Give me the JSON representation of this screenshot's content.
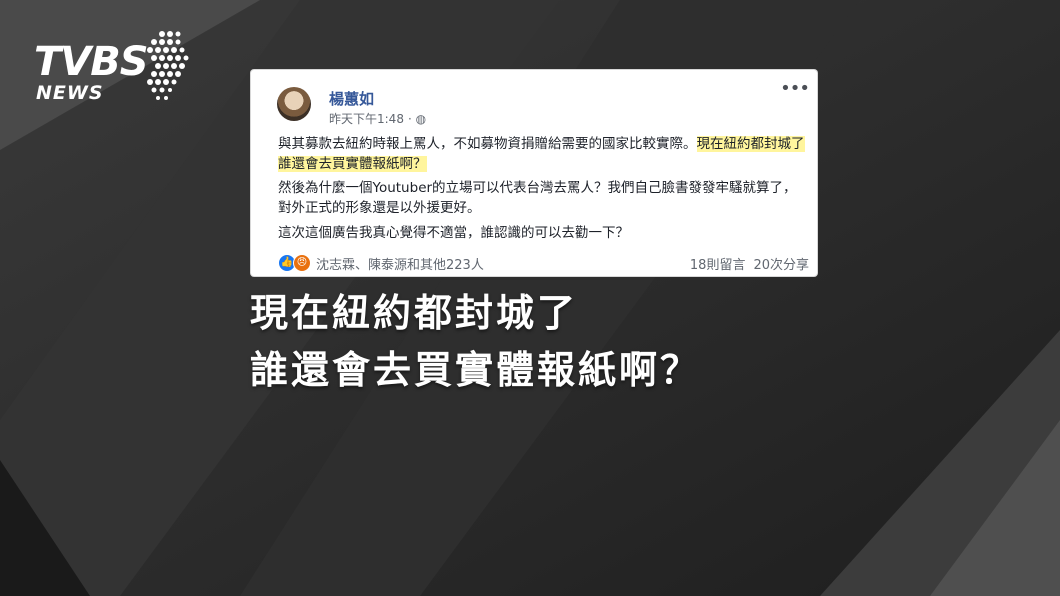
{
  "logo": {
    "brand": "TVBS",
    "subtitle": "NEWS"
  },
  "post": {
    "author": "楊蕙如",
    "timestamp": "昨天下午1:48",
    "privacy_icon": "globe-icon",
    "paragraph1_plain": "與其募款去紐約時報上罵人，不如募物資捐贈給需要的國家比較實際。",
    "paragraph1_highlight": "現在紐約都封城了誰還會去買實體報紙啊？",
    "paragraph2": "然後為什麼一個Youtuber的立場可以代表台灣去罵人？我們自己臉書發發牢騷就算了，對外正式的形象還是以外援更好。",
    "paragraph3": "這次這個廣告我真心覺得不適當，誰認識的可以去勸一下？",
    "reactions": {
      "icons": [
        "like-icon",
        "angry-icon"
      ],
      "names": "沈志霖、陳泰源和其他223人"
    },
    "comments": "18則留言",
    "shares": "20次分享"
  },
  "caption": {
    "line1": "現在紐約都封城了",
    "line2": "誰還會去買實體報紙啊？"
  }
}
